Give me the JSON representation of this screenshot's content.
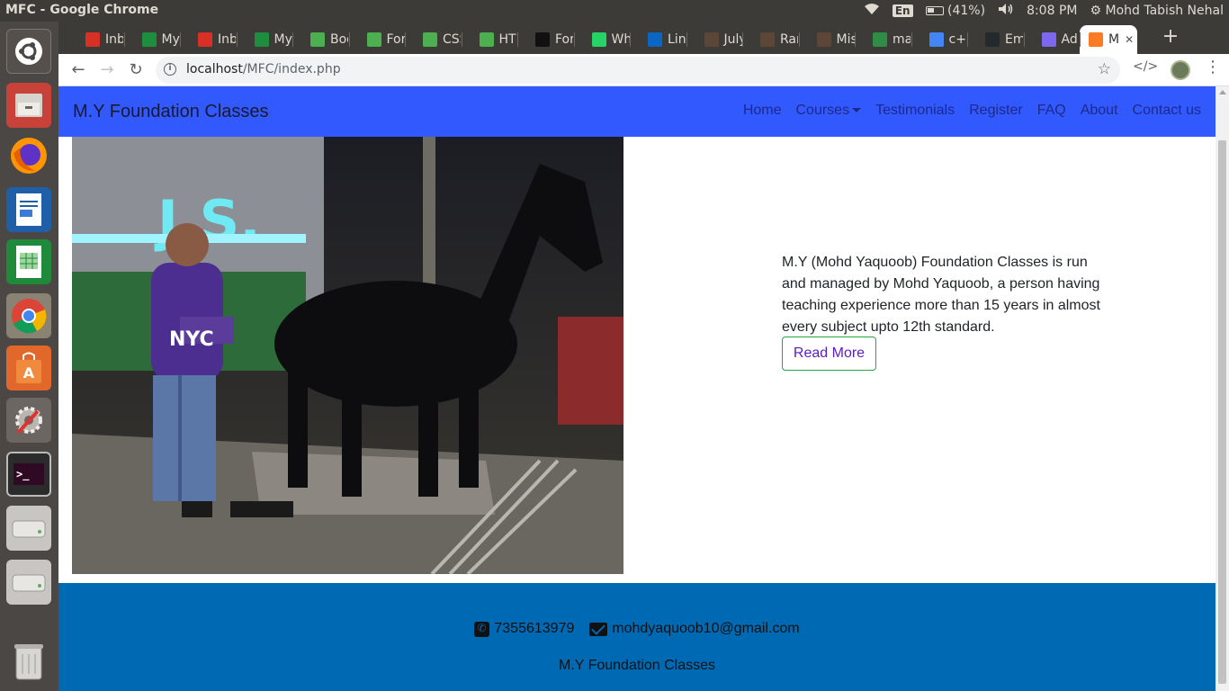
{
  "os": {
    "window_title": "MFC - Google Chrome",
    "keyboard_layout": "En",
    "battery": "(41%)",
    "time": "8:08 PM",
    "user": "Mohd Tabish Nehal"
  },
  "launcher": {
    "items": [
      "ubuntu-dash",
      "files",
      "firefox",
      "libreoffice-writer",
      "libreoffice-calc",
      "chrome",
      "software-center",
      "system-settings",
      "terminal",
      "drive-1",
      "drive-2",
      "trash"
    ]
  },
  "browser": {
    "tabs": [
      {
        "label": "Inb",
        "icon": "gmail-icon",
        "color": "#d93025"
      },
      {
        "label": "My",
        "icon": "drive-icon",
        "color": "#1e8e3e"
      },
      {
        "label": "Inb",
        "icon": "gmail-icon",
        "color": "#d93025"
      },
      {
        "label": "My",
        "icon": "drive-icon",
        "color": "#1e8e3e"
      },
      {
        "label": "Boo",
        "icon": "w3schools-icon",
        "color": "#4caf50"
      },
      {
        "label": "For",
        "icon": "w3schools-icon",
        "color": "#4caf50"
      },
      {
        "label": "CSS",
        "icon": "w3schools-icon",
        "color": "#4caf50"
      },
      {
        "label": "HTM",
        "icon": "w3schools-icon",
        "color": "#4caf50"
      },
      {
        "label": "For",
        "icon": "flag-icon",
        "color": "#111111"
      },
      {
        "label": "Wh",
        "icon": "whatsapp-icon",
        "color": "#25d366"
      },
      {
        "label": "Lin",
        "icon": "linkedin-icon",
        "color": "#0a66c2"
      },
      {
        "label": "July",
        "icon": "codechef-icon",
        "color": "#5b4638"
      },
      {
        "label": "Ran",
        "icon": "codechef-icon",
        "color": "#5b4638"
      },
      {
        "label": "Mis",
        "icon": "codechef-icon",
        "color": "#5b4638"
      },
      {
        "label": "ma",
        "icon": "geeks-icon",
        "color": "#2f8d46"
      },
      {
        "label": "c++",
        "icon": "google-icon",
        "color": "#4285f4"
      },
      {
        "label": "Em",
        "icon": "github-icon",
        "color": "#24292e"
      },
      {
        "label": "Ad",
        "icon": "addon-icon",
        "color": "#7b68ee"
      },
      {
        "label": "M",
        "icon": "xampp-icon",
        "color": "#fb7a24"
      }
    ],
    "url_host": "localhost",
    "url_path": "/MFC/index.php"
  },
  "site": {
    "brand": "M.Y Foundation Classes",
    "nav": {
      "home": "Home",
      "courses": "Courses",
      "testimonials": "Testimonials",
      "register": "Register",
      "faq": "FAQ",
      "about": "About",
      "contact": "Contact us"
    },
    "about_text": "M.Y (Mohd Yaquoob) Foundation Classes is run and managed by Mohd Yaquoob, a person having teaching experience more than 15 years in almost every subject upto 12th standard.",
    "read_more": "Read More",
    "footer": {
      "phone": "7355613979",
      "email": "mohdyaquoob10@gmail.com",
      "org": "M.Y Foundation Classes"
    }
  },
  "colors": {
    "navbar": "#3159fe",
    "footer": "#0069b4",
    "read_more_border": "#28a745"
  }
}
